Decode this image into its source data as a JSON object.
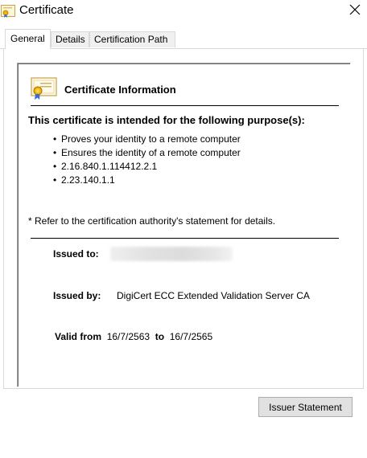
{
  "window": {
    "title": "Certificate",
    "title_icon": "certificate-icon",
    "close_icon": "close-icon"
  },
  "tabs": [
    {
      "label": "General",
      "active": true
    },
    {
      "label": "Details",
      "active": false
    },
    {
      "label": "Certification Path",
      "active": false
    }
  ],
  "info": {
    "icon": "certificate-icon",
    "heading": "Certificate Information",
    "purpose_heading": "This certificate is intended for the following purpose(s):",
    "purposes": [
      "Proves your identity to a remote computer",
      "Ensures the identity of a remote computer",
      "2.16.840.1.114412.2.1",
      "2.23.140.1.1"
    ],
    "bullet": "•",
    "note": "* Refer to the certification authority's statement for details."
  },
  "details": {
    "issued_to_label": "Issued to:",
    "issued_to_value_redacted": true,
    "issued_by_label": "Issued by:",
    "issued_by_value": "DigiCert ECC Extended Validation Server CA",
    "valid_from_label": "Valid from",
    "valid_from_value": "16/7/2563",
    "valid_to_label": "to",
    "valid_to_value": "16/7/2565"
  },
  "buttons": {
    "issuer_statement": "Issuer Statement"
  },
  "colors": {
    "button_bg": "#e1e1e1",
    "border": "#d9d9d9",
    "certificate_ribbon": "#f0b400"
  }
}
